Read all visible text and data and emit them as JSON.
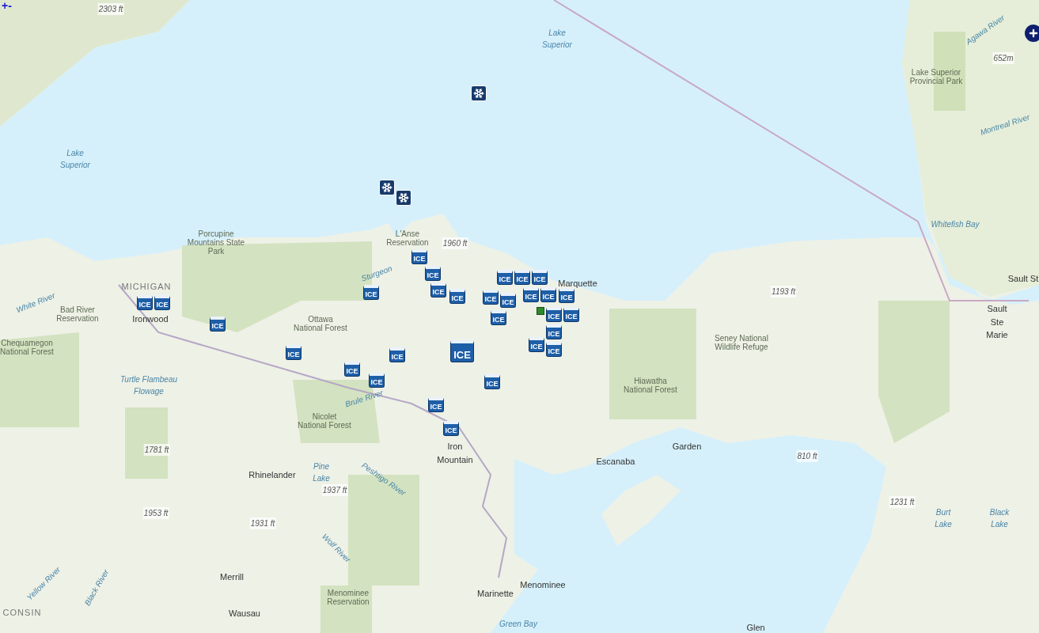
{
  "zoom_controls": {
    "zoom_in": "+",
    "zoom_out": "-"
  },
  "map_labels": [
    {
      "kind": "elevation",
      "text": "2303 ft"
    },
    {
      "kind": "water",
      "text": "Lake Superior"
    },
    {
      "kind": "area",
      "text": "Lake Superior Provincial Park"
    },
    {
      "kind": "elevation",
      "text": "652m"
    },
    {
      "kind": "water",
      "text": "Agawa River"
    },
    {
      "kind": "water",
      "text": "Montreal River"
    },
    {
      "kind": "water",
      "text": "Lake Superior"
    },
    {
      "kind": "water",
      "text": "Whitefish Bay"
    },
    {
      "kind": "place",
      "text": "Sault St"
    },
    {
      "kind": "place",
      "text": "Sault Ste Marie"
    },
    {
      "kind": "area",
      "text": "Porcupine Mountains State Park"
    },
    {
      "kind": "area",
      "text": "L'Anse Reservation"
    },
    {
      "kind": "elevation",
      "text": "1960 ft"
    },
    {
      "kind": "water",
      "text": "Sturgeon"
    },
    {
      "kind": "state",
      "text": "MICHIGAN"
    },
    {
      "kind": "place",
      "text": "Marquette"
    },
    {
      "kind": "water",
      "text": "White River"
    },
    {
      "kind": "area",
      "text": "Bad River Reservation"
    },
    {
      "kind": "place",
      "text": "Ironwood"
    },
    {
      "kind": "elevation",
      "text": "1193 ft"
    },
    {
      "kind": "area",
      "text": "Ottawa National Forest"
    },
    {
      "kind": "area",
      "text": "Chequamegon National Forest"
    },
    {
      "kind": "area",
      "text": "Seney National Wildlife Refuge"
    },
    {
      "kind": "water",
      "text": "Turtle Flambeau Flowage"
    },
    {
      "kind": "area",
      "text": "Hiawatha National Forest"
    },
    {
      "kind": "water",
      "text": "Brule River"
    },
    {
      "kind": "area",
      "text": "Nicolet National Forest"
    },
    {
      "kind": "elevation",
      "text": "1781 ft"
    },
    {
      "kind": "place",
      "text": "Iron Mountain"
    },
    {
      "kind": "place",
      "text": "Rhinelander"
    },
    {
      "kind": "water",
      "text": "Pine Lake"
    },
    {
      "kind": "water",
      "text": "Peshtigo River"
    },
    {
      "kind": "elevation",
      "text": "1937 ft"
    },
    {
      "kind": "place",
      "text": "Escanaba"
    },
    {
      "kind": "place",
      "text": "Garden"
    },
    {
      "kind": "elevation",
      "text": "810 ft"
    },
    {
      "kind": "elevation",
      "text": "1231 ft"
    },
    {
      "kind": "elevation",
      "text": "1953 ft"
    },
    {
      "kind": "elevation",
      "text": "1931 ft"
    },
    {
      "kind": "water",
      "text": "Burt Lake"
    },
    {
      "kind": "water",
      "text": "Black Lake"
    },
    {
      "kind": "water",
      "text": "Wolf River"
    },
    {
      "kind": "water",
      "text": "Yellow River"
    },
    {
      "kind": "water",
      "text": "Black River"
    },
    {
      "kind": "place",
      "text": "Merrill"
    },
    {
      "kind": "area",
      "text": "Menominee Reservation"
    },
    {
      "kind": "place",
      "text": "Marinette"
    },
    {
      "kind": "place",
      "text": "Menominee"
    },
    {
      "kind": "state",
      "text": "CONSIN"
    },
    {
      "kind": "place",
      "text": "Wausau"
    },
    {
      "kind": "water",
      "text": "Green Bay"
    },
    {
      "kind": "place",
      "text": "Glen"
    }
  ],
  "markers": [
    {
      "kind": "snow"
    },
    {
      "kind": "snow"
    },
    {
      "kind": "snow"
    },
    {
      "kind": "ice",
      "label": "ICE",
      "large": false
    },
    {
      "kind": "ice",
      "label": "ICE",
      "large": false
    },
    {
      "kind": "ice",
      "label": "ICE",
      "large": false
    },
    {
      "kind": "ice",
      "label": "ICE",
      "large": false
    },
    {
      "kind": "ice",
      "label": "ICE",
      "large": false
    },
    {
      "kind": "ice",
      "label": "ICE",
      "large": false
    },
    {
      "kind": "ice",
      "label": "ICE",
      "large": false
    },
    {
      "kind": "ice",
      "label": "ICE",
      "large": false
    },
    {
      "kind": "ice",
      "label": "ICE",
      "large": false
    },
    {
      "kind": "ice",
      "label": "ICE",
      "large": false
    },
    {
      "kind": "ice",
      "label": "ICE",
      "large": false
    },
    {
      "kind": "ice",
      "label": "ICE",
      "large": false
    },
    {
      "kind": "ice",
      "label": "ICE",
      "large": false
    },
    {
      "kind": "ice",
      "label": "ICE",
      "large": false
    },
    {
      "kind": "ice",
      "label": "ICE",
      "large": false
    },
    {
      "kind": "ice",
      "label": "ICE",
      "large": false
    },
    {
      "kind": "ice",
      "label": "ICE",
      "large": false
    },
    {
      "kind": "ice",
      "label": "ICE",
      "large": false
    },
    {
      "kind": "site"
    },
    {
      "kind": "ice",
      "label": "ICE",
      "large": false
    },
    {
      "kind": "ice",
      "label": "ICE",
      "large": false
    },
    {
      "kind": "ice",
      "label": "ICE",
      "large": false
    },
    {
      "kind": "ice",
      "label": "ICE",
      "large": false
    },
    {
      "kind": "ice",
      "label": "ICE",
      "large": false
    },
    {
      "kind": "ice",
      "label": "ICE",
      "large": false
    },
    {
      "kind": "ice",
      "label": "ICE",
      "large": true
    },
    {
      "kind": "ice",
      "label": "ICE",
      "large": false
    },
    {
      "kind": "ice",
      "label": "ICE",
      "large": false
    },
    {
      "kind": "ice",
      "label": "ICE",
      "large": false
    },
    {
      "kind": "ice",
      "label": "ICE",
      "large": false
    },
    {
      "kind": "ice",
      "label": "ICE",
      "large": false
    }
  ]
}
